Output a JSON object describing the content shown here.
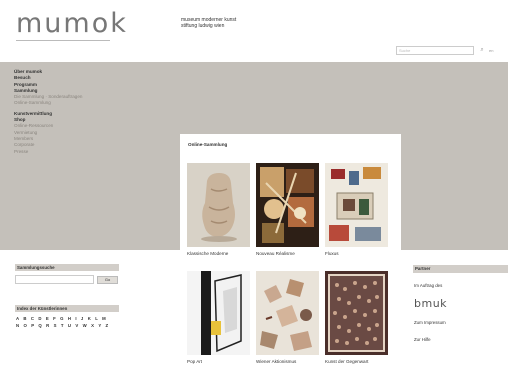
{
  "header": {
    "logo": "mumok",
    "tagline_line1": "museum moderner kunst",
    "tagline_line2": "stiftung ludwig wien"
  },
  "search": {
    "placeholder": "Suche",
    "button_glyph": "⌕",
    "lang": "en"
  },
  "nav": {
    "items": [
      {
        "label": "Über mumok",
        "style": "bold"
      },
      {
        "label": "Besuch",
        "style": "bold"
      },
      {
        "label": "Programm",
        "style": "bold"
      },
      {
        "label": "Sammlung",
        "style": "bold"
      },
      {
        "label": "Die Sammlung · Sonderauftragen",
        "style": "light"
      },
      {
        "label": "Online-Sammlung",
        "style": "light"
      },
      {
        "label": "Kunstvermittlung",
        "style": "bold"
      },
      {
        "label": "Shop",
        "style": "bold"
      },
      {
        "label": "Online-Ressourcen",
        "style": "light"
      },
      {
        "label": "Vermietung",
        "style": "light"
      },
      {
        "label": "Members",
        "style": "light"
      },
      {
        "label": "Corporate",
        "style": "light"
      },
      {
        "label": "Presse",
        "style": "light"
      }
    ]
  },
  "collection": {
    "title": "Online-Sammlung",
    "items": [
      {
        "label": "Klassische Moderne"
      },
      {
        "label": "Nouveau Réalisme"
      },
      {
        "label": "Fluxus"
      },
      {
        "label": "Pop Art"
      },
      {
        "label": "Wiener Aktionismus"
      },
      {
        "label": "Kunst der Gegenwart"
      }
    ]
  },
  "sidebar_left": {
    "search_title": "Sammlungssuche",
    "search_button": "Go",
    "index_title": "Index der Künstlerinnen",
    "alphabet_row1": "A B C D E F G H I J K L M",
    "alphabet_row2": "N O P Q R S T U V W X Y Z"
  },
  "sidebar_right": {
    "title": "Partner",
    "link1": "Im Auftrag des",
    "brand": "bmuk",
    "link2": "Zum Impressum",
    "link3": "Zur Hilfe"
  },
  "colors": {
    "band": "#c4c0ba",
    "box_title": "#d2cec9"
  }
}
